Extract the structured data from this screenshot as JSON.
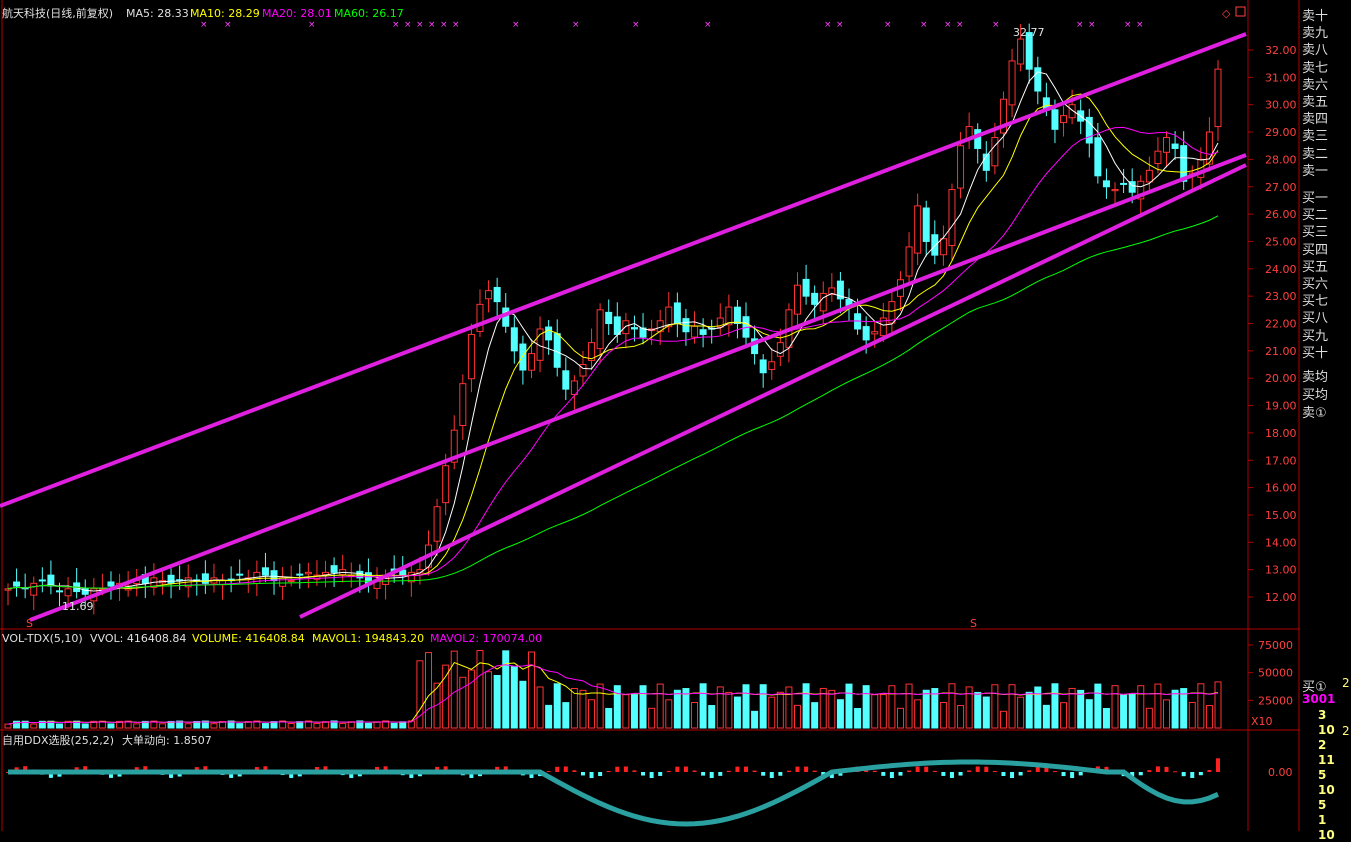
{
  "header": {
    "stock": "航天科技(日线,前复权)",
    "ma5_label": "MA5: 28.33",
    "ma10_label": "MA10: 28.29",
    "ma20_label": "MA20: 28.01",
    "ma60_label": "MA60: 26.17",
    "high_marker": "32.77",
    "low_marker": "11.69",
    "s_marker": "S"
  },
  "vol_panel": {
    "name": "VOL-TDX(5,10)",
    "vvol": "VVOL: 416408.84",
    "volume": "VOLUME: 416408.84",
    "mavol1": "MAVOL1: 194843.20",
    "mavol2": "MAVOL2: 170074.00",
    "unit": "X10"
  },
  "ddx_panel": {
    "name": "自用DDX选股(25,2,2)",
    "label": "大单动向: 1.8507"
  },
  "colors": {
    "up": "#ff3232",
    "down": "#54ffff",
    "ma5": "#ffffff",
    "ma10": "#ffff00",
    "ma20": "#ff00ff",
    "ma60": "#00ff00",
    "channel": "#e020e0",
    "axis": "#b00000",
    "tick_text": "#ff4040",
    "ddx_pos": "#ff7070",
    "ddx_neg": "#2aa0a0"
  },
  "order_book": {
    "sell": [
      "卖十",
      "卖九",
      "卖八",
      "卖七",
      "卖六",
      "卖五",
      "卖四",
      "卖三",
      "卖二",
      "卖一"
    ],
    "buy": [
      "买一",
      "买二",
      "买三",
      "买四",
      "买五",
      "买六",
      "买七",
      "买八",
      "买九",
      "买十"
    ],
    "sell_avg": "卖均",
    "buy_avg": "买均",
    "sell_1": "卖①",
    "buy_1": "买①",
    "buy_1_qty": "3001",
    "side_digits": [
      "3",
      "10",
      "2",
      "11",
      "5",
      "10",
      "5",
      "1",
      "10"
    ],
    "side_digits_2": [
      "2",
      "2"
    ]
  },
  "chart_data": {
    "type": "candlestick",
    "price_axis": [
      "32.00",
      "31.00",
      "30.00",
      "29.00",
      "28.00",
      "27.00",
      "26.00",
      "25.00",
      "24.00",
      "23.00",
      "22.00",
      "21.00",
      "20.00",
      "19.00",
      "18.00",
      "17.00",
      "16.00",
      "15.00",
      "14.00",
      "13.00",
      "12.00"
    ],
    "vol_axis": [
      "75000",
      "50000",
      "25000"
    ],
    "ddx_axis": [
      "0.00"
    ],
    "high": 32.77,
    "low": 11.69,
    "closes": [
      12.3,
      12.4,
      12.3,
      12.5,
      12.6,
      12.4,
      12.2,
      12.3,
      12.2,
      12.1,
      12.3,
      12.3,
      12.4,
      12.5,
      12.4,
      12.6,
      12.5,
      12.7,
      12.6,
      12.5,
      12.6,
      12.7,
      12.6,
      12.5,
      12.7,
      12.6,
      12.6,
      12.8,
      12.7,
      12.9,
      12.8,
      12.6,
      12.7,
      12.6,
      12.8,
      12.9,
      12.8,
      12.9,
      12.9,
      13.0,
      12.8,
      12.7,
      12.5,
      12.6,
      12.8,
      12.9,
      12.8,
      12.9,
      13.0,
      13.9,
      15.3,
      16.8,
      18.1,
      19.8,
      21.6,
      22.7,
      23.2,
      22.8,
      21.9,
      21.0,
      20.3,
      20.9,
      21.8,
      21.4,
      20.4,
      19.6,
      19.9,
      20.5,
      21.3,
      22.5,
      22.0,
      21.6,
      22.1,
      21.8,
      21.5,
      21.8,
      22.1,
      22.6,
      22.0,
      21.7,
      21.9,
      21.6,
      21.8,
      22.2,
      22.6,
      22.0,
      21.5,
      20.9,
      20.2,
      20.6,
      21.3,
      22.5,
      23.4,
      23.0,
      22.7,
      23.1,
      23.3,
      22.9,
      22.6,
      21.8,
      21.4,
      21.7,
      22.2,
      22.8,
      23.6,
      24.8,
      26.3,
      25.0,
      24.5,
      25.1,
      26.9,
      28.5,
      29.2,
      28.4,
      27.6,
      28.8,
      30.2,
      31.6,
      32.4,
      31.3,
      30.5,
      29.8,
      29.1,
      29.6,
      30.0,
      29.4,
      28.6,
      27.4,
      27.0,
      26.9,
      27.1,
      26.8,
      27.2,
      27.6,
      28.3,
      28.8,
      28.4,
      27.2,
      27.5,
      28.0,
      29.0,
      31.3
    ],
    "vol_tail": 41640.884,
    "ddx_value": 1.8507
  }
}
